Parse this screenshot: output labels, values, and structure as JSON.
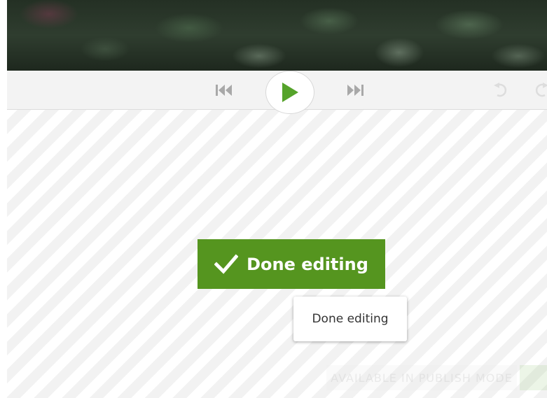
{
  "video": {
    "preview_icon": "video-frame-thumbnail"
  },
  "toolbar": {
    "prev_icon": "skip-back-icon",
    "play_icon": "play-icon",
    "next_icon": "skip-forward-icon",
    "undo_icon": "undo-icon",
    "redo_icon": "redo-icon"
  },
  "main": {
    "done_button_label": "Done editing",
    "done_button_icon": "checkmark-icon",
    "tooltip_text": "Done editing",
    "watermark_text": "AVAILABLE IN PUBLISH MODE"
  },
  "colors": {
    "accent": "#55951f",
    "play_icon": "#55a32a",
    "control_gray": "#a8a8a8",
    "toolbar_bg": "#f3f3f3"
  }
}
